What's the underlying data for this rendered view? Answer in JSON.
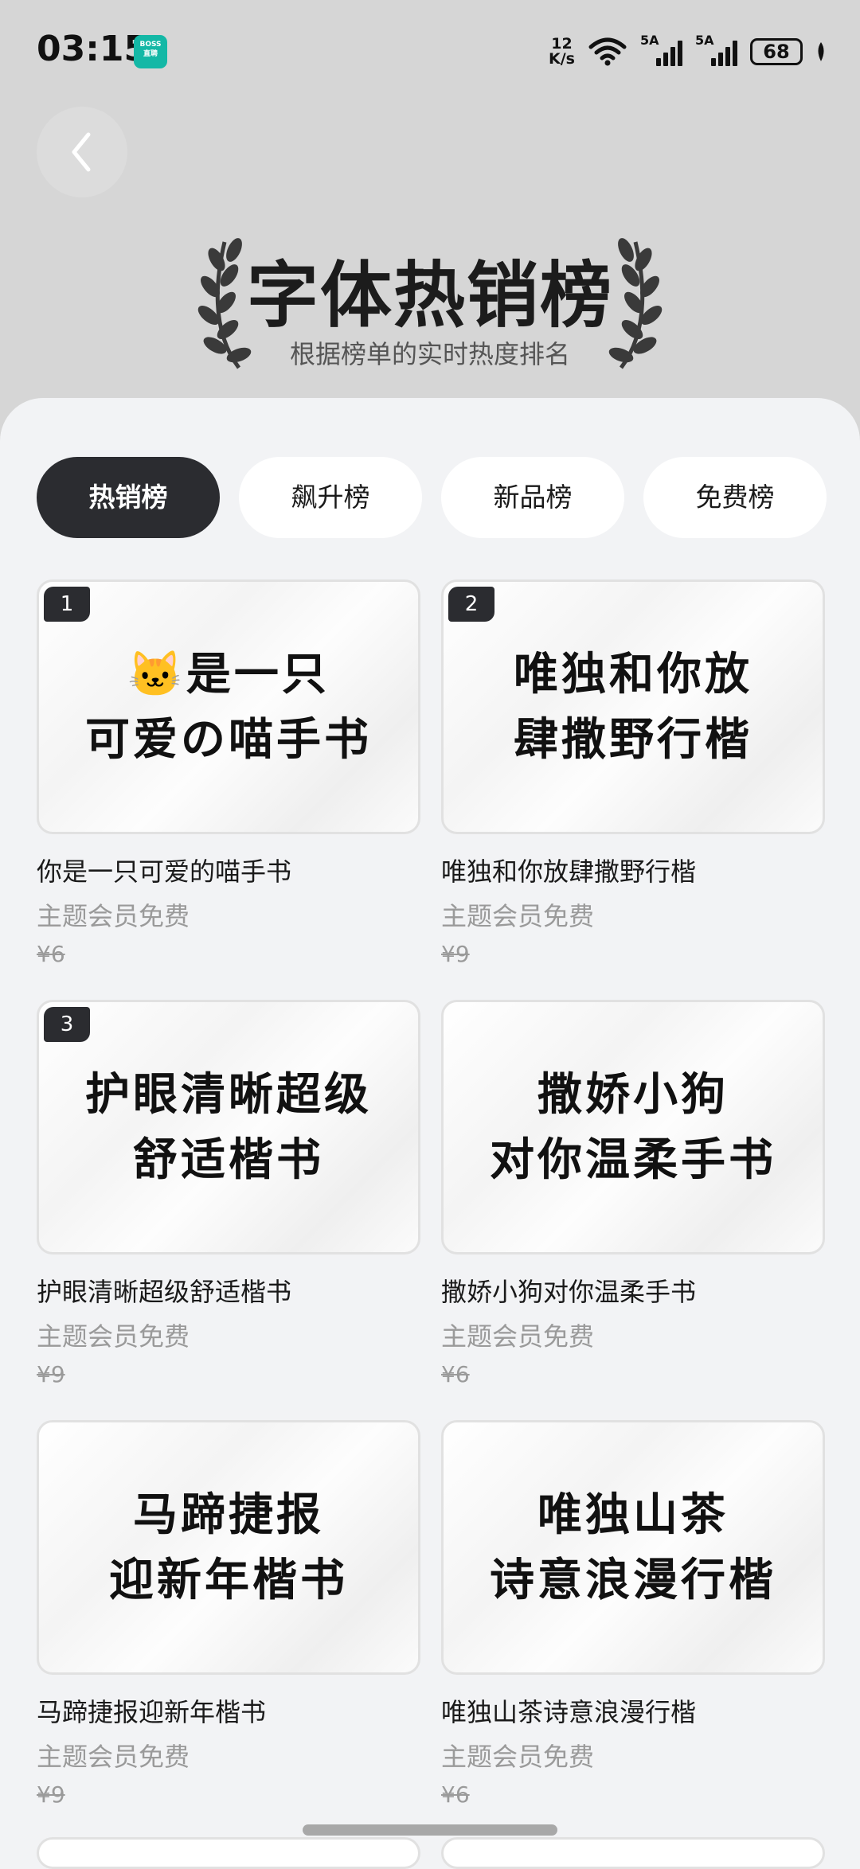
{
  "status_bar": {
    "time": "03:15",
    "app_badge": "BOSS\n直聘",
    "net_speed_value": "12",
    "net_speed_unit": "K/s",
    "sim1_label": "5A",
    "sim2_label": "5A",
    "battery": "68",
    "icons": [
      "boss-app-icon",
      "wifi-icon",
      "signal-icon",
      "signal-icon",
      "battery-icon",
      "leaf-icon"
    ]
  },
  "header": {
    "title": "字体热销榜",
    "subtitle": "根据榜单的实时热度排名"
  },
  "tabs": [
    {
      "label": "热销榜",
      "active": true
    },
    {
      "label": "飙升榜",
      "active": false
    },
    {
      "label": "新品榜",
      "active": false
    },
    {
      "label": "免费榜",
      "active": false
    }
  ],
  "fonts": [
    {
      "rank": "1",
      "preview": "🐱是一只\n可爱の喵手书",
      "title": "你是一只可爱的喵手书",
      "member": "主题会员免费",
      "price": "¥6"
    },
    {
      "rank": "2",
      "preview": "唯独和你放\n肆撒野行楷",
      "title": "唯独和你放肆撒野行楷",
      "member": "主题会员免费",
      "price": "¥9"
    },
    {
      "rank": "3",
      "preview": "护眼清晰超级\n舒适楷书",
      "title": "护眼清晰超级舒适楷书",
      "member": "主题会员免费",
      "price": "¥9"
    },
    {
      "rank": "",
      "preview": "撒娇小狗\n对你温柔手书",
      "title": "撒娇小狗对你温柔手书",
      "member": "主题会员免费",
      "price": "¥6"
    },
    {
      "rank": "",
      "preview": "马蹄捷报\n迎新年楷书",
      "title": "马蹄捷报迎新年楷书",
      "member": "主题会员免费",
      "price": "¥9"
    },
    {
      "rank": "",
      "preview": "唯独山茶\n诗意浪漫行楷",
      "title": "唯独山茶诗意浪漫行楷",
      "member": "主题会员免费",
      "price": "¥6"
    }
  ],
  "colors": {
    "header_bg": "#d6d6d6",
    "page_bg": "#f2f3f5",
    "active_tab": "#2b2c30",
    "muted_text": "#9a9a9a"
  }
}
